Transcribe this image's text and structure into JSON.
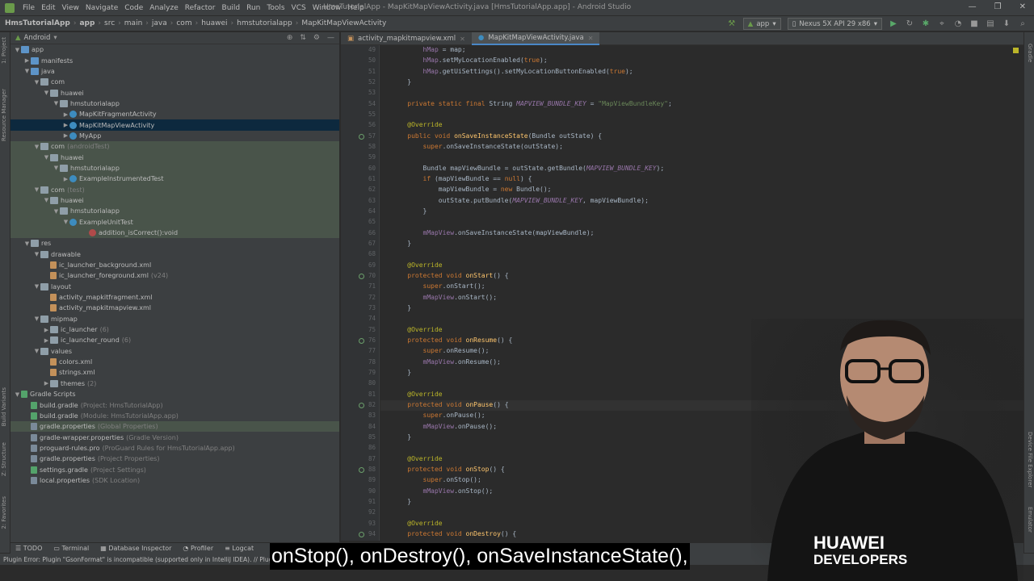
{
  "menu": {
    "items": [
      "File",
      "Edit",
      "View",
      "Navigate",
      "Code",
      "Analyze",
      "Refactor",
      "Build",
      "Run",
      "Tools",
      "VCS",
      "Window",
      "Help"
    ],
    "window_title": "HmsTutorialApp - MapKitMapViewActivity.java [HmsTutorialApp.app] - Android Studio"
  },
  "breadcrumb": [
    "HmsTutorialApp",
    "app",
    "src",
    "main",
    "java",
    "com",
    "huawei",
    "hmstutorialapp",
    "MapKitMapViewActivity"
  ],
  "run": {
    "config": "app",
    "device": "Nexus 5X API 29 x86"
  },
  "project": {
    "view": "Android",
    "tree": [
      {
        "label": "app",
        "hint": "",
        "indent": 0,
        "arrow": "▼",
        "icon": "folderblue",
        "style": ""
      },
      {
        "label": "manifests",
        "hint": "",
        "indent": 1,
        "arrow": "▶",
        "icon": "folderblue",
        "style": ""
      },
      {
        "label": "java",
        "hint": "",
        "indent": 1,
        "arrow": "▼",
        "icon": "folderblue",
        "style": ""
      },
      {
        "label": "com",
        "hint": "",
        "indent": 2,
        "arrow": "▼",
        "icon": "pkg",
        "style": ""
      },
      {
        "label": "huawei",
        "hint": "",
        "indent": 3,
        "arrow": "▼",
        "icon": "pkg",
        "style": ""
      },
      {
        "label": "hmstutorialapp",
        "hint": "",
        "indent": 4,
        "arrow": "▼",
        "icon": "pkg",
        "style": ""
      },
      {
        "label": "MapKitFragmentActivity",
        "hint": "",
        "indent": 5,
        "arrow": "▶",
        "icon": "cls",
        "style": ""
      },
      {
        "label": "MapKitMapViewActivity",
        "hint": "",
        "indent": 5,
        "arrow": "▶",
        "icon": "cls",
        "style": "sel"
      },
      {
        "label": "MyApp",
        "hint": "",
        "indent": 5,
        "arrow": "▶",
        "icon": "cls",
        "style": ""
      },
      {
        "label": "com",
        "hint": "(androidTest)",
        "indent": 2,
        "arrow": "▼",
        "icon": "pkg",
        "style": "test"
      },
      {
        "label": "huawei",
        "hint": "",
        "indent": 3,
        "arrow": "▼",
        "icon": "pkg",
        "style": "test"
      },
      {
        "label": "hmstutorialapp",
        "hint": "",
        "indent": 4,
        "arrow": "▼",
        "icon": "pkg",
        "style": "test"
      },
      {
        "label": "ExampleInstrumentedTest",
        "hint": "",
        "indent": 5,
        "arrow": "▶",
        "icon": "cls",
        "style": "test"
      },
      {
        "label": "com",
        "hint": "(test)",
        "indent": 2,
        "arrow": "▼",
        "icon": "pkg",
        "style": "test"
      },
      {
        "label": "huawei",
        "hint": "",
        "indent": 3,
        "arrow": "▼",
        "icon": "pkg",
        "style": "test"
      },
      {
        "label": "hmstutorialapp",
        "hint": "",
        "indent": 4,
        "arrow": "▼",
        "icon": "pkg",
        "style": "test"
      },
      {
        "label": "ExampleUnitTest",
        "hint": "",
        "indent": 5,
        "arrow": "▼",
        "icon": "cls",
        "style": "test"
      },
      {
        "label": "addition_isCorrect():void",
        "hint": "",
        "indent": 7,
        "arrow": "",
        "icon": "method",
        "style": "test"
      },
      {
        "label": "res",
        "hint": "",
        "indent": 1,
        "arrow": "▼",
        "icon": "folder",
        "style": ""
      },
      {
        "label": "drawable",
        "hint": "",
        "indent": 2,
        "arrow": "▼",
        "icon": "folder",
        "style": ""
      },
      {
        "label": "ic_launcher_background.xml",
        "hint": "",
        "indent": 3,
        "arrow": "",
        "icon": "file",
        "style": ""
      },
      {
        "label": "ic_launcher_foreground.xml",
        "hint": "(v24)",
        "indent": 3,
        "arrow": "",
        "icon": "file",
        "style": ""
      },
      {
        "label": "layout",
        "hint": "",
        "indent": 2,
        "arrow": "▼",
        "icon": "folder",
        "style": ""
      },
      {
        "label": "activity_mapkitfragment.xml",
        "hint": "",
        "indent": 3,
        "arrow": "",
        "icon": "file",
        "style": ""
      },
      {
        "label": "activity_mapkitmapview.xml",
        "hint": "",
        "indent": 3,
        "arrow": "",
        "icon": "file",
        "style": ""
      },
      {
        "label": "mipmap",
        "hint": "",
        "indent": 2,
        "arrow": "▼",
        "icon": "folder",
        "style": ""
      },
      {
        "label": "ic_launcher",
        "hint": "(6)",
        "indent": 3,
        "arrow": "▶",
        "icon": "folder",
        "style": ""
      },
      {
        "label": "ic_launcher_round",
        "hint": "(6)",
        "indent": 3,
        "arrow": "▶",
        "icon": "folder",
        "style": ""
      },
      {
        "label": "values",
        "hint": "",
        "indent": 2,
        "arrow": "▼",
        "icon": "folder",
        "style": ""
      },
      {
        "label": "colors.xml",
        "hint": "",
        "indent": 3,
        "arrow": "",
        "icon": "file",
        "style": ""
      },
      {
        "label": "strings.xml",
        "hint": "",
        "indent": 3,
        "arrow": "",
        "icon": "file",
        "style": ""
      },
      {
        "label": "themes",
        "hint": "(2)",
        "indent": 3,
        "arrow": "▶",
        "icon": "folder",
        "style": ""
      },
      {
        "label": "Gradle Scripts",
        "hint": "",
        "indent": 0,
        "arrow": "▼",
        "icon": "gradle",
        "style": ""
      },
      {
        "label": "build.gradle",
        "hint": "(Project: HmsTutorialApp)",
        "indent": 1,
        "arrow": "",
        "icon": "gradle",
        "style": ""
      },
      {
        "label": "build.gradle",
        "hint": "(Module: HmsTutorialApp.app)",
        "indent": 1,
        "arrow": "",
        "icon": "gradle",
        "style": ""
      },
      {
        "label": "gradle.properties",
        "hint": "(Global Properties)",
        "indent": 1,
        "arrow": "",
        "icon": "props",
        "style": "test"
      },
      {
        "label": "gradle-wrapper.properties",
        "hint": "(Gradle Version)",
        "indent": 1,
        "arrow": "",
        "icon": "props",
        "style": ""
      },
      {
        "label": "proguard-rules.pro",
        "hint": "(ProGuard Rules for HmsTutorialApp.app)",
        "indent": 1,
        "arrow": "",
        "icon": "props",
        "style": ""
      },
      {
        "label": "gradle.properties",
        "hint": "(Project Properties)",
        "indent": 1,
        "arrow": "",
        "icon": "props",
        "style": ""
      },
      {
        "label": "settings.gradle",
        "hint": "(Project Settings)",
        "indent": 1,
        "arrow": "",
        "icon": "gradle",
        "style": ""
      },
      {
        "label": "local.properties",
        "hint": "(SDK Location)",
        "indent": 1,
        "arrow": "",
        "icon": "props",
        "style": ""
      }
    ]
  },
  "tabs": [
    {
      "label": "activity_mapkitmapview.xml",
      "active": false
    },
    {
      "label": "MapKitMapViewActivity.java",
      "active": true
    }
  ],
  "editor": {
    "current_line": "82",
    "lines": [
      {
        "n": "49",
        "html": "        <span class='fld'>hMap</span> = map;"
      },
      {
        "n": "50",
        "html": "        <span class='fld'>hMap</span>.setMyLocationEnabled(<span class='kw'>true</span>);"
      },
      {
        "n": "51",
        "html": "        <span class='fld'>hMap</span>.getUiSettings().setMyLocationButtonEnabled(<span class='kw'>true</span>);"
      },
      {
        "n": "52",
        "html": "    }"
      },
      {
        "n": "53",
        "html": ""
      },
      {
        "n": "54",
        "html": "    <span class='kw'>private static final</span> String <span class='cst'>MAPVIEW_BUNDLE_KEY</span> = <span class='str'>\"MapViewBundleKey\"</span>;"
      },
      {
        "n": "55",
        "html": ""
      },
      {
        "n": "56",
        "html": "    <span class='ann'>@Override</span>"
      },
      {
        "n": "57",
        "html": "    <span class='kw'>public void</span> <span class='fn'>onSaveInstanceState</span>(Bundle outState) {"
      },
      {
        "n": "58",
        "html": "        <span class='kw'>super</span>.onSaveInstanceState(outState);"
      },
      {
        "n": "59",
        "html": ""
      },
      {
        "n": "60",
        "html": "        Bundle mapViewBundle = outState.getBundle(<span class='cst'>MAPVIEW_BUNDLE_KEY</span>);"
      },
      {
        "n": "61",
        "html": "        <span class='kw'>if</span> (mapViewBundle == <span class='kw'>null</span>) {"
      },
      {
        "n": "62",
        "html": "            mapViewBundle = <span class='kw'>new</span> Bundle();"
      },
      {
        "n": "63",
        "html": "            outState.putBundle(<span class='cst'>MAPVIEW_BUNDLE_KEY</span>, mapViewBundle);"
      },
      {
        "n": "64",
        "html": "        }"
      },
      {
        "n": "65",
        "html": ""
      },
      {
        "n": "66",
        "html": "        <span class='fld'>mMapView</span>.onSaveInstanceState(mapViewBundle);"
      },
      {
        "n": "67",
        "html": "    }"
      },
      {
        "n": "68",
        "html": ""
      },
      {
        "n": "69",
        "html": "    <span class='ann'>@Override</span>"
      },
      {
        "n": "70",
        "html": "    <span class='kw'>protected void</span> <span class='fn'>onStart</span>() {"
      },
      {
        "n": "71",
        "html": "        <span class='kw'>super</span>.onStart();"
      },
      {
        "n": "72",
        "html": "        <span class='fld'>mMapView</span>.onStart();"
      },
      {
        "n": "73",
        "html": "    }"
      },
      {
        "n": "74",
        "html": ""
      },
      {
        "n": "75",
        "html": "    <span class='ann'>@Override</span>"
      },
      {
        "n": "76",
        "html": "    <span class='kw'>protected void</span> <span class='fn'>onResume</span>() {"
      },
      {
        "n": "77",
        "html": "        <span class='kw'>super</span>.onResume();"
      },
      {
        "n": "78",
        "html": "        <span class='fld'>mMapView</span>.onResume();"
      },
      {
        "n": "79",
        "html": "    }"
      },
      {
        "n": "80",
        "html": ""
      },
      {
        "n": "81",
        "html": "    <span class='ann'>@Override</span>"
      },
      {
        "n": "82",
        "html": "    <span class='kw'>protected void</span> <span class='fn'>onPause</span>() {"
      },
      {
        "n": "83",
        "html": "        <span class='kw'>super</span>.onPause();"
      },
      {
        "n": "84",
        "html": "        <span class='fld'>mMapView</span>.onPause();"
      },
      {
        "n": "85",
        "html": "    }"
      },
      {
        "n": "86",
        "html": ""
      },
      {
        "n": "87",
        "html": "    <span class='ann'>@Override</span>"
      },
      {
        "n": "88",
        "html": "    <span class='kw'>protected void</span> <span class='fn'>onStop</span>() {"
      },
      {
        "n": "89",
        "html": "        <span class='kw'>super</span>.onStop();"
      },
      {
        "n": "90",
        "html": "        <span class='fld'>mMapView</span>.onStop();"
      },
      {
        "n": "91",
        "html": "    }"
      },
      {
        "n": "92",
        "html": ""
      },
      {
        "n": "93",
        "html": "    <span class='ann'>@Override</span>"
      },
      {
        "n": "94",
        "html": "    <span class='kw'>protected void</span> <span class='fn'>onDestroy</span>() {"
      }
    ]
  },
  "bottom_tools": [
    "TODO",
    "Terminal",
    "Database Inspector",
    "Profiler",
    "Logcat"
  ],
  "side_labels_left": [
    "1: Project",
    "Resource Manager",
    "Build Variants",
    "Z: Structure",
    "2: Favorites"
  ],
  "side_labels_right": [
    "Gradle",
    "Device File Explorer",
    "Emulator"
  ],
  "status": "Plugin Error: Plugin \"GsonFormat\" is incompatible (supported only in IntelliJ IDEA). // Plugin",
  "subtitle": "onStop(), onDestroy(), onSaveInstanceState(),",
  "logo": {
    "line1": "HUAWEI",
    "line2": "DEVELOPERS"
  },
  "colors": {
    "accent": "#4a88c7",
    "background": "#2b2b2b",
    "panel": "#3c3f41",
    "selection": "#0d293e"
  }
}
